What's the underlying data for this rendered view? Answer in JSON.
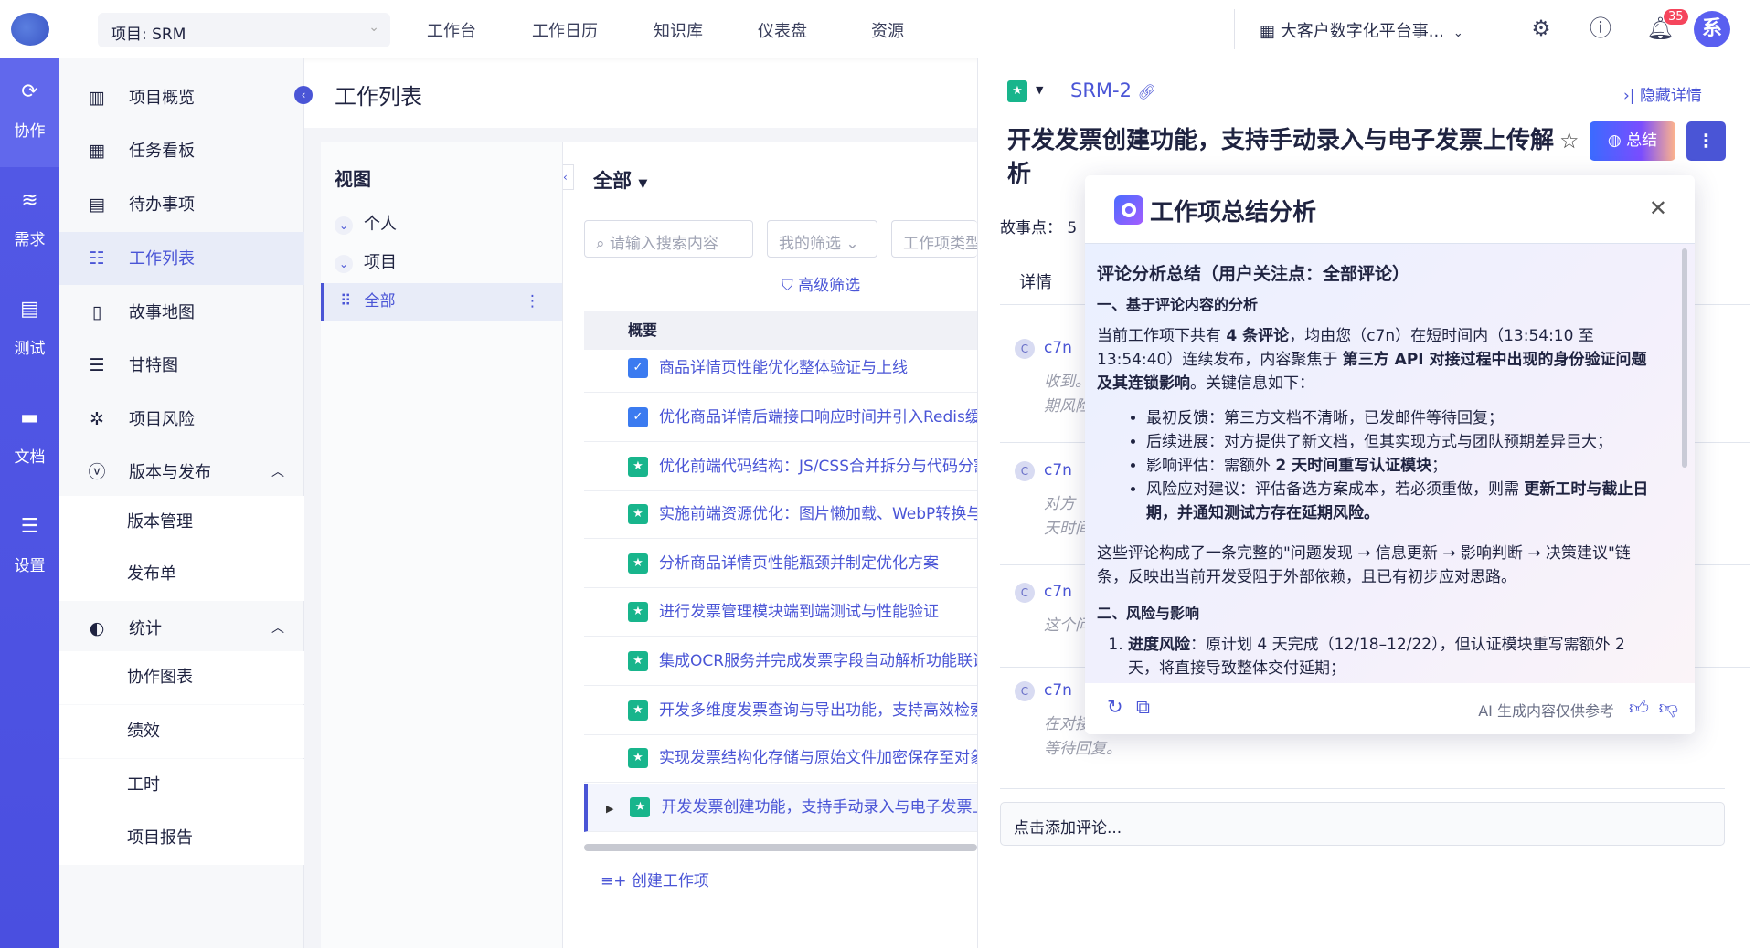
{
  "topbar": {
    "project": "项目: SRM",
    "nav": [
      "工作台",
      "工作日历",
      "知识库",
      "仪表盘",
      "资源"
    ],
    "org": "大客户数字化平台事...",
    "notif_count": "35",
    "avatar": "系"
  },
  "rail": [
    {
      "label": "协作",
      "icon": "collab-icon"
    },
    {
      "label": "需求",
      "icon": "layers-icon"
    },
    {
      "label": "测试",
      "icon": "clipboard-icon"
    },
    {
      "label": "文档",
      "icon": "inbox-icon"
    },
    {
      "label": "设置",
      "icon": "database-icon"
    }
  ],
  "sidebar": {
    "items": [
      "项目概览",
      "任务看板",
      "待办事项",
      "工作列表",
      "故事地图",
      "甘特图",
      "项目风险",
      "版本与发布",
      "版本管理",
      "发布单",
      "统计",
      "协作图表",
      "绩效",
      "工时",
      "项目报告"
    ]
  },
  "page_title": "工作列表",
  "views": {
    "title": "视图",
    "groups": [
      "个人",
      "项目"
    ],
    "selected": "全部"
  },
  "list": {
    "header": "全部",
    "search_placeholder": "请输入搜索内容",
    "my_filter": "我的筛选",
    "type_filter": "工作项类型",
    "advanced": "高级筛选",
    "column": "概要",
    "rows": [
      "商品详情页性能优化整体验证与上线",
      "优化商品详情后端接口响应时间并引入Redis缓存",
      "优化前端代码结构：JS/CSS合并拆分与代码分割",
      "实施前端资源优化：图片懒加载、WebP转换与",
      "分析商品详情页性能瓶颈并制定优化方案",
      "进行发票管理模块端到端测试与性能验证",
      "集成OCR服务并完成发票字段自动解析功能联调",
      "开发多维度发票查询与导出功能，支持高效检索",
      "实现发票结构化存储与原始文件加密保存至对象存储",
      "开发发票创建功能，支持手动录入与电子发票上传解析"
    ],
    "create": "创建工作项"
  },
  "detail": {
    "key": "SRM-2",
    "hide": "隐藏详情",
    "title": "开发发票创建功能，支持手动录入与电子发票上传解析",
    "summary_btn": "总结",
    "story_points_label": "故事点：",
    "story_points": "5",
    "tab": "详情",
    "comments": [
      {
        "user": "c7n",
        "text": [
          "收到。",
          "期风险"
        ]
      },
      {
        "user": "c7n",
        "text": [
          "对方",
          "天时间"
        ]
      },
      {
        "user": "c7n",
        "text": [
          "这个问"
        ]
      },
      {
        "user": "c7n",
        "text": [
          "在对接",
          "等待回复。"
        ]
      }
    ],
    "comment_placeholder": "点击添加评论..."
  },
  "popup": {
    "title": "工作项总结分析",
    "heading": "评论分析总结（用户关注点：全部评论）",
    "sec1": "一、基于评论内容的分析",
    "p1a": "当前工作项下共有 ",
    "p1b": "4 条评论",
    "p1c": "，均由您（c7n）在短时间内（13:54:10 至 13:54:40）连续发布，内容聚焦于 ",
    "p1d": "第三方 API 对接过程中出现的身份验证问题及其连锁影响",
    "p1e": "。关键信息如下：",
    "b1": "最初反馈：第三方文档不清晰，已发邮件等待回复；",
    "b2": "后续进展：对方提供了新文档，但其实现方式与团队预期差异巨大；",
    "b3a": "影响评估：需额外 ",
    "b3b": "2 天时间重写认证模块",
    "b3c": "；",
    "b4a": "风险应对建议：评估备选方案成本，若必须重做，则需 ",
    "b4b": "更新工时与截止日期，并通知测试方存在延期风险。",
    "p2": "这些评论构成了一条完整的\"问题发现 → 信息更新 → 影响判断 → 决策建议\"链条，反映出当前开发受阻于外部依赖，且已有初步应对思路。",
    "sec2": "二、风险与影响",
    "o1a": "进度风险",
    "o1b": "：原计划 4 天完成（12/18–12/22），但认证模块重写需额外 2 天，将直接导致整体交付延期；",
    "footer_note": "AI 生成内容仅供参考"
  }
}
